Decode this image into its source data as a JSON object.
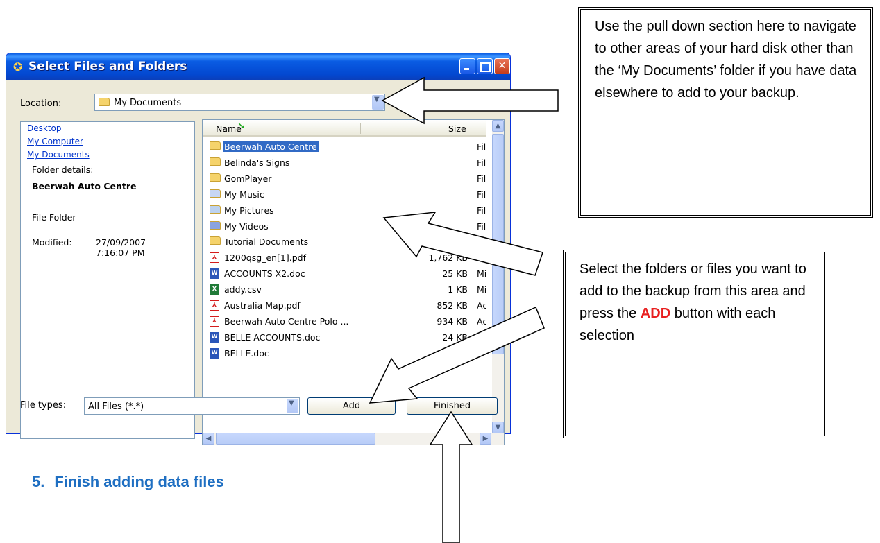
{
  "dialog": {
    "title": "Select Files and Folders",
    "title_icon": "✪",
    "location_label": "Location:",
    "location_value": "My Documents",
    "left_pane": {
      "links": [
        "Desktop",
        "My Computer",
        "My Documents"
      ],
      "details_label": "Folder details:",
      "selected_name": "Beerwah Auto Centre",
      "selected_type": "File Folder",
      "modified_label": "Modified:",
      "modified_date": "27/09/2007",
      "modified_time": "7:16:07 PM"
    },
    "list": {
      "col_name": "Name",
      "col_size": "Size",
      "rows": [
        {
          "name": "Beerwah Auto Centre",
          "size": "",
          "type": "Fil",
          "icon": "folder-icon"
        },
        {
          "name": "Belinda's Signs",
          "size": "",
          "type": "Fil",
          "icon": "folder-icon"
        },
        {
          "name": "GomPlayer",
          "size": "",
          "type": "Fil",
          "icon": "folder-icon"
        },
        {
          "name": "My Music",
          "size": "",
          "type": "Fil",
          "icon": "music-folder-icon"
        },
        {
          "name": "My Pictures",
          "size": "",
          "type": "Fil",
          "icon": "pictures-folder-icon"
        },
        {
          "name": "My Videos",
          "size": "",
          "type": "Fil",
          "icon": "videos-folder-icon"
        },
        {
          "name": "Tutorial Documents",
          "size": "",
          "type": "",
          "icon": "folder-icon"
        },
        {
          "name": "1200qsg_en[1].pdf",
          "size": "1,762 KB",
          "type": "Ac",
          "icon": "pdf-icon"
        },
        {
          "name": "ACCOUNTS X2.doc",
          "size": "25 KB",
          "type": "Mi",
          "icon": "word-doc-icon"
        },
        {
          "name": "addy.csv",
          "size": "1 KB",
          "type": "Mi",
          "icon": "excel-icon"
        },
        {
          "name": "Australia Map.pdf",
          "size": "852 KB",
          "type": "Ac",
          "icon": "pdf-icon"
        },
        {
          "name": "Beerwah Auto Centre Polo ...",
          "size": "934 KB",
          "type": "Ac",
          "icon": "pdf-icon"
        },
        {
          "name": "BELLE ACCOUNTS.doc",
          "size": "24 KB",
          "type": "Mi",
          "icon": "word-doc-icon"
        },
        {
          "name": "BELLE.doc",
          "size": "25",
          "type": "",
          "icon": "word-doc-icon"
        }
      ]
    },
    "file_types_label": "File types:",
    "file_types_value": "All Files (*.*)",
    "add_label": "Add",
    "finished_label": "Finished"
  },
  "callouts": {
    "top": "Use the pull down section here to navigate to other areas of your hard disk other than the ‘My Documents’ folder if you have data elsewhere to add to your backup.",
    "middle_before": "Select the folders or files you want to add to the backup from this area and press the ",
    "middle_highlight": "ADD",
    "middle_after": " button with each selection"
  },
  "heading": {
    "number": "5.",
    "text": "Finish adding data files"
  },
  "colors": {
    "titlebar": "#0a5ce3",
    "selection": "#316ac5",
    "heading": "#1f6fc2",
    "highlight": "#e82020"
  }
}
